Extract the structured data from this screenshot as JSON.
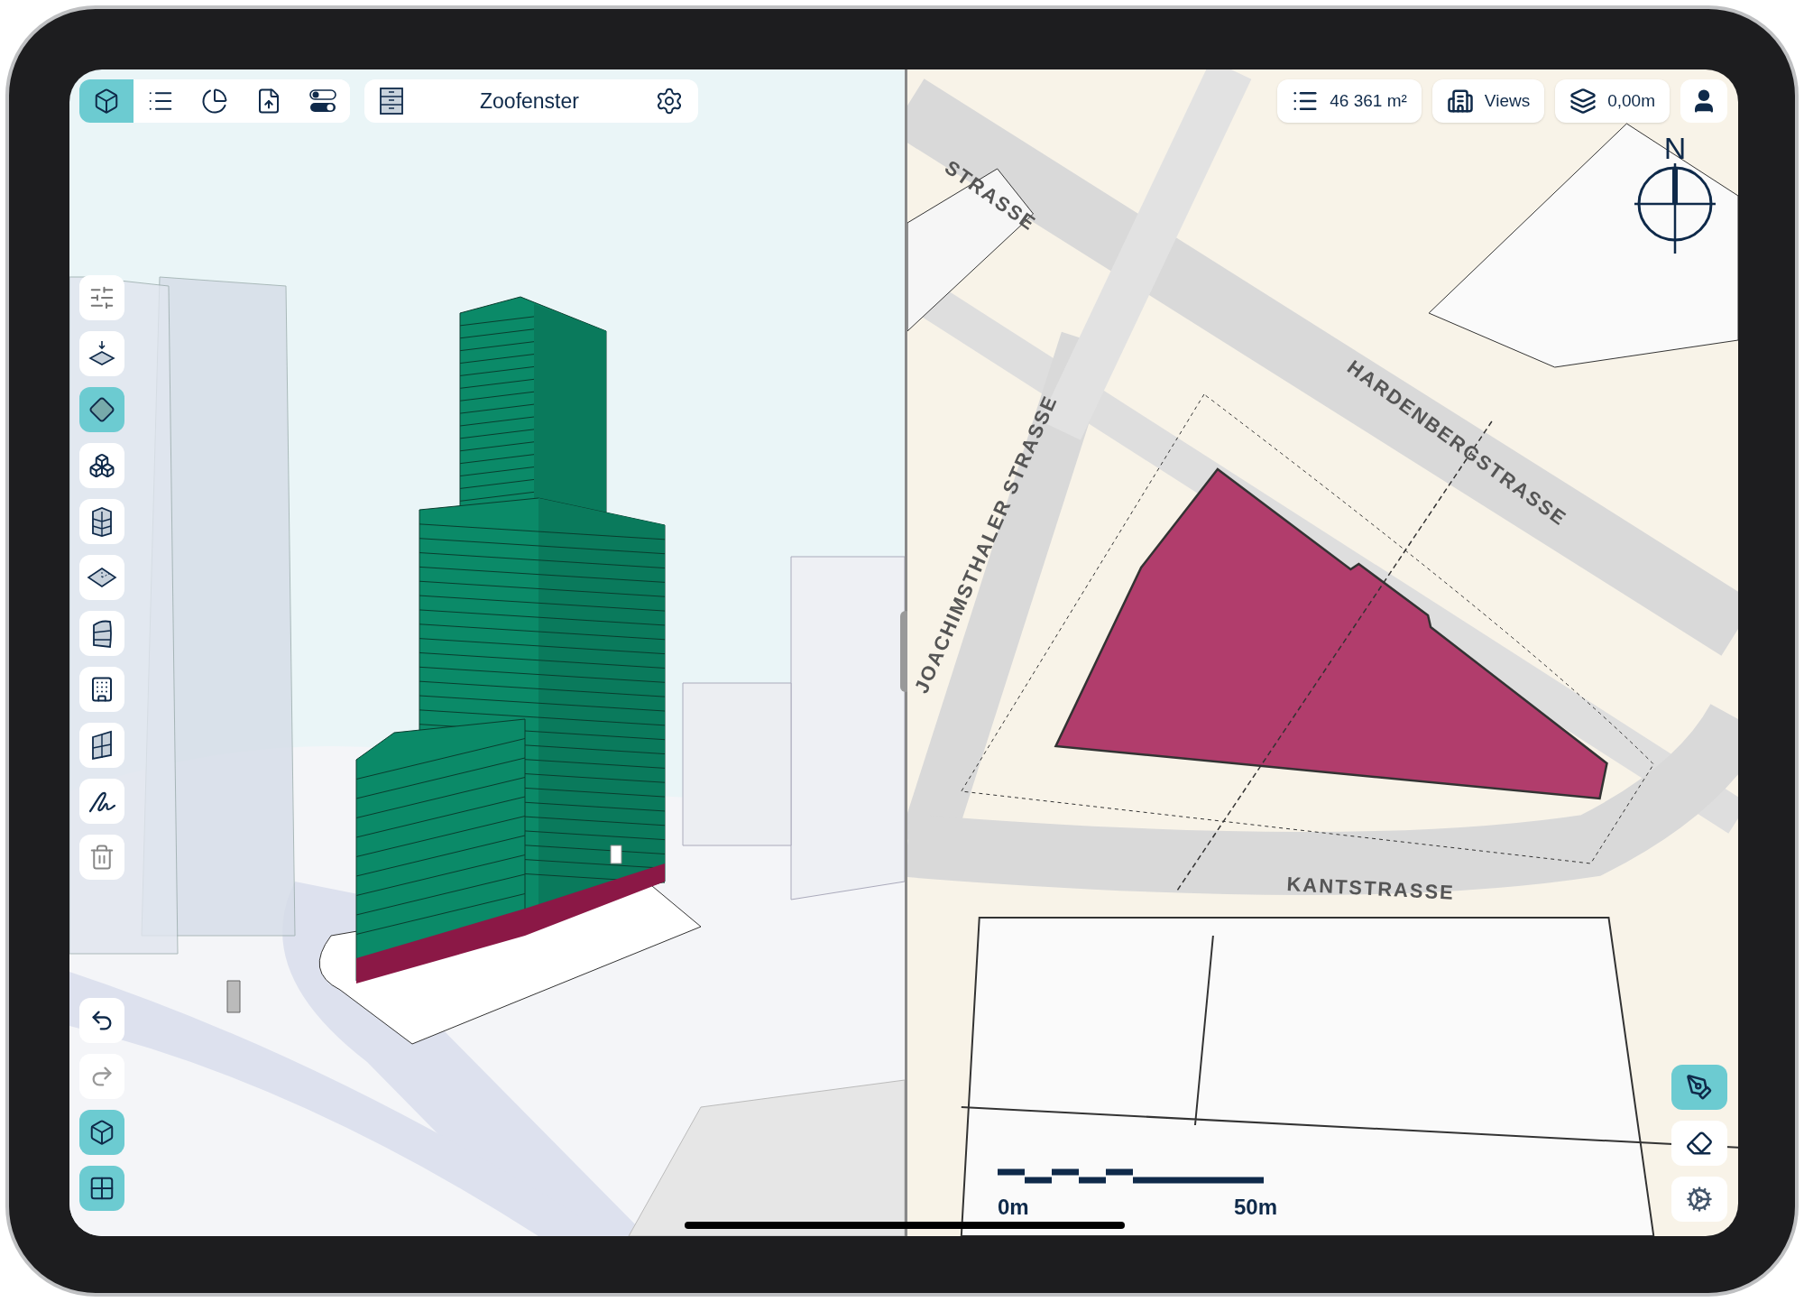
{
  "top_tools": [
    {
      "selected": true
    },
    {
      "selected": false
    },
    {
      "selected": false
    },
    {
      "selected": false
    },
    {
      "selected": false
    }
  ],
  "project": {
    "title": "Zoofenster"
  },
  "side_tools": [
    {
      "selected": false
    },
    {
      "selected": false
    },
    {
      "selected": true
    },
    {
      "selected": false
    },
    {
      "selected": false
    },
    {
      "selected": false
    },
    {
      "selected": false
    },
    {
      "selected": false
    },
    {
      "selected": false
    },
    {
      "selected": false
    },
    {
      "selected": false
    }
  ],
  "history": [
    {
      "disabled": false
    },
    {
      "disabled": true
    }
  ],
  "view_modes": [
    {
      "selected": true
    },
    {
      "selected": true
    }
  ],
  "map_toolbar": {
    "area": "46 361 m²",
    "views": "Views",
    "elevation": "0,00m"
  },
  "street_labels": [
    "STRASSE",
    "JOACHIMSTHALER STRASSE",
    "HARDENBERGSTRASSE",
    "KANTSTRASSE"
  ],
  "compass": "N",
  "scale_bar": {
    "start": "0m",
    "end": "50m"
  },
  "map_tools": [
    {
      "selected": true
    },
    {
      "selected": false
    },
    {
      "selected": false
    }
  ]
}
